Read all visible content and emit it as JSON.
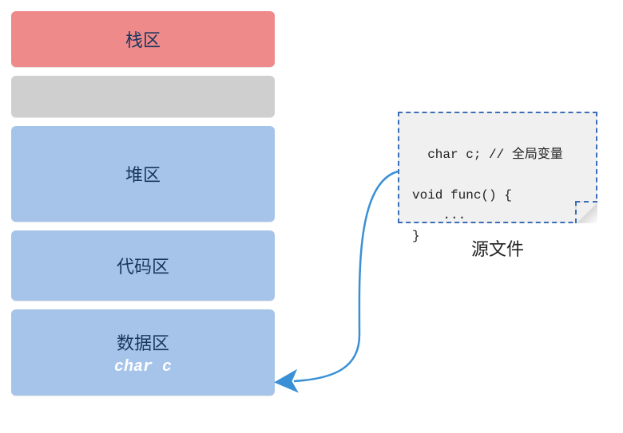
{
  "regions": {
    "stack": "栈区",
    "gap": "",
    "heap": "堆区",
    "code": "代码区",
    "data": "数据区",
    "data_var": "char c"
  },
  "source": {
    "code": "char c; // 全局变量\n\nvoid func() {\n    ...\n}",
    "label": "源文件"
  },
  "arrow": {
    "color": "#3a90d6"
  }
}
